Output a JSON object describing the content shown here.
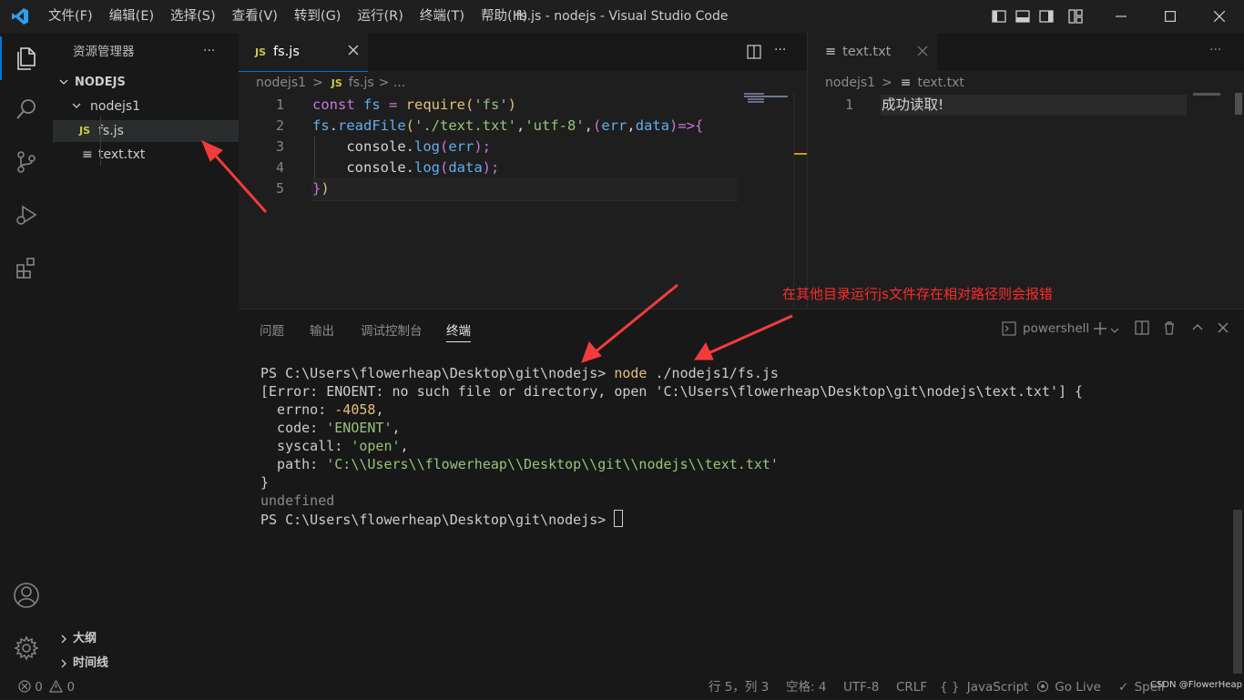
{
  "window": {
    "title": "fs.js - nodejs - Visual Studio Code"
  },
  "menu": [
    "文件(F)",
    "编辑(E)",
    "选择(S)",
    "查看(V)",
    "转到(G)",
    "运行(R)",
    "终端(T)",
    "帮助(H)"
  ],
  "sidebar": {
    "title": "资源管理器",
    "more": "···",
    "root": "NODEJS",
    "folder": "nodejs1",
    "files": [
      {
        "badge": "JS",
        "name": "fs.js"
      },
      {
        "badge": "≡",
        "name": "text.txt"
      }
    ],
    "outline": "大纲",
    "timeline": "时间线"
  },
  "editor_left": {
    "tab_badge": "JS",
    "tab_label": "fs.js",
    "breadcrumb": {
      "folder": "nodejs1",
      "sep": ">",
      "badge": "JS",
      "file": "fs.js",
      "rest": "> ..."
    },
    "line_numbers": [
      "1",
      "2",
      "3",
      "4",
      "5"
    ],
    "lines": [
      [
        {
          "t": "const ",
          "c": "kw"
        },
        {
          "t": "fs",
          "c": "var"
        },
        {
          "t": " = ",
          "c": "kw"
        },
        {
          "t": "require",
          "c": "fn"
        },
        {
          "t": "(",
          "c": "fn"
        },
        {
          "t": "'fs'",
          "c": "str"
        },
        {
          "t": ")",
          "c": "fn"
        }
      ],
      [
        {
          "t": "fs",
          "c": "var"
        },
        {
          "t": ".",
          "c": "pl"
        },
        {
          "t": "readFile",
          "c": "var"
        },
        {
          "t": "(",
          "c": "fn"
        },
        {
          "t": "'./text.txt'",
          "c": "str"
        },
        {
          "t": ",",
          "c": "pl"
        },
        {
          "t": "'utf-8'",
          "c": "str"
        },
        {
          "t": ",",
          "c": "pl"
        },
        {
          "t": "(",
          "c": "kw"
        },
        {
          "t": "err",
          "c": "var"
        },
        {
          "t": ",",
          "c": "pl"
        },
        {
          "t": "data",
          "c": "var"
        },
        {
          "t": ")",
          "c": "kw"
        },
        {
          "t": "=>",
          "c": "kw"
        },
        {
          "t": "{",
          "c": "kw"
        }
      ],
      [
        {
          "t": "    console",
          "c": "pl"
        },
        {
          "t": ".",
          "c": "pl"
        },
        {
          "t": "log",
          "c": "var"
        },
        {
          "t": "(",
          "c": "kw"
        },
        {
          "t": "err",
          "c": "var"
        },
        {
          "t": ");",
          "c": "kw"
        }
      ],
      [
        {
          "t": "    console",
          "c": "pl"
        },
        {
          "t": ".",
          "c": "pl"
        },
        {
          "t": "log",
          "c": "var"
        },
        {
          "t": "(",
          "c": "kw"
        },
        {
          "t": "data",
          "c": "var"
        },
        {
          "t": ");",
          "c": "kw"
        }
      ],
      [
        {
          "t": "}",
          "c": "kw"
        },
        {
          "t": ")",
          "c": "fn"
        }
      ]
    ]
  },
  "editor_right": {
    "tab_badge": "≡",
    "tab_label": "text.txt",
    "breadcrumb": {
      "folder": "nodejs1",
      "sep": ">",
      "badge": "≡",
      "file": "text.txt"
    },
    "line_number": "1",
    "content": "成功读取!"
  },
  "annotation": "在其他目录运行js文件存在相对路径则会报错",
  "panel": {
    "tabs": [
      "问题",
      "输出",
      "调试控制台",
      "终端"
    ],
    "shell": "powershell",
    "terminal": [
      [
        {
          "t": "PS C:\\Users\\flowerheap\\Desktop\\git\\nodejs> ",
          "c": "#cccccc"
        },
        {
          "t": "node",
          "c": "#e5c07b"
        },
        {
          "t": " ./nodejs1/fs.js",
          "c": "#cccccc"
        }
      ],
      [
        {
          "t": "[Error: ENOENT: no such file or directory, open 'C:\\Users\\flowerheap\\Desktop\\git\\nodejs\\text.txt'] {",
          "c": "#cccccc"
        }
      ],
      [
        {
          "t": "  errno: ",
          "c": "#cccccc"
        },
        {
          "t": "-4058",
          "c": "#e5c07b"
        },
        {
          "t": ",",
          "c": "#cccccc"
        }
      ],
      [
        {
          "t": "  code: ",
          "c": "#cccccc"
        },
        {
          "t": "'ENOENT'",
          "c": "#98c379"
        },
        {
          "t": ",",
          "c": "#cccccc"
        }
      ],
      [
        {
          "t": "  syscall: ",
          "c": "#cccccc"
        },
        {
          "t": "'open'",
          "c": "#98c379"
        },
        {
          "t": ",",
          "c": "#cccccc"
        }
      ],
      [
        {
          "t": "  path: ",
          "c": "#cccccc"
        },
        {
          "t": "'C:\\\\Users\\\\flowerheap\\\\Desktop\\\\git\\\\nodejs\\\\text.txt'",
          "c": "#98c379"
        }
      ],
      [
        {
          "t": "}",
          "c": "#cccccc"
        }
      ],
      [
        {
          "t": "undefined",
          "c": "#8a8a8a"
        }
      ],
      [
        {
          "t": "PS C:\\Users\\flowerheap\\Desktop\\git\\nodejs> ",
          "c": "#cccccc"
        }
      ]
    ]
  },
  "statusbar": {
    "errors": "0",
    "warnings": "0",
    "position": "行 5，列 3",
    "spaces": "空格: 4",
    "encoding": "UTF-8",
    "eol": "CRLF",
    "language": "JavaScript",
    "golive": "Go Live",
    "spell": "Spell",
    "watermark": "CSDN @FlowerHeap"
  },
  "colors": {
    "accent": "#0078d4",
    "annotation": "#ff2a2a",
    "js_badge": "#cbcb41"
  }
}
